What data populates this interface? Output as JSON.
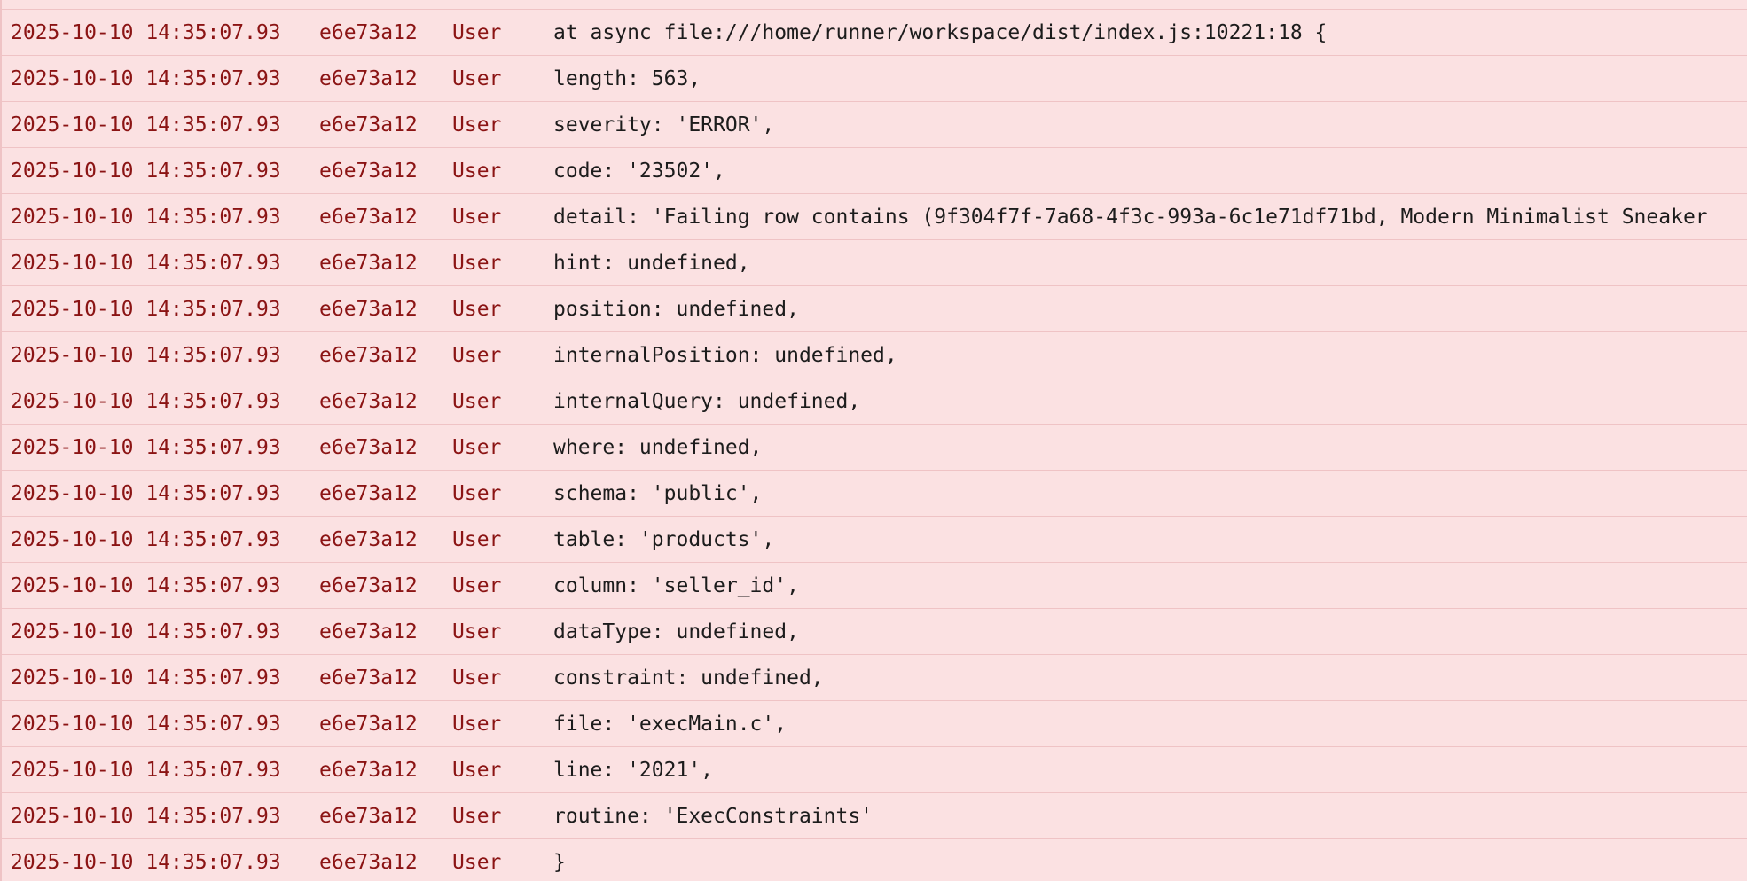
{
  "colors": {
    "background": "#fbe1e2",
    "separator": "#efc3c5",
    "meta_text": "#8b1414",
    "message_text": "#1c1c1c"
  },
  "log_rows": [
    {
      "timestamp": "2025-10-10 14:35:07.93",
      "id": "e6e73a12",
      "source": "User",
      "message": "at async file:///home/runner/workspace/dist/index.js:10221:18 {"
    },
    {
      "timestamp": "2025-10-10 14:35:07.93",
      "id": "e6e73a12",
      "source": "User",
      "message": "length: 563,"
    },
    {
      "timestamp": "2025-10-10 14:35:07.93",
      "id": "e6e73a12",
      "source": "User",
      "message": "severity: 'ERROR',"
    },
    {
      "timestamp": "2025-10-10 14:35:07.93",
      "id": "e6e73a12",
      "source": "User",
      "message": "code: '23502',"
    },
    {
      "timestamp": "2025-10-10 14:35:07.93",
      "id": "e6e73a12",
      "source": "User",
      "message": "detail: 'Failing row contains (9f304f7f-7a68-4f3c-993a-6c1e71df71bd, Modern Minimalist Sneaker"
    },
    {
      "timestamp": "2025-10-10 14:35:07.93",
      "id": "e6e73a12",
      "source": "User",
      "message": "hint: undefined,"
    },
    {
      "timestamp": "2025-10-10 14:35:07.93",
      "id": "e6e73a12",
      "source": "User",
      "message": "position: undefined,"
    },
    {
      "timestamp": "2025-10-10 14:35:07.93",
      "id": "e6e73a12",
      "source": "User",
      "message": "internalPosition: undefined,"
    },
    {
      "timestamp": "2025-10-10 14:35:07.93",
      "id": "e6e73a12",
      "source": "User",
      "message": "internalQuery: undefined,"
    },
    {
      "timestamp": "2025-10-10 14:35:07.93",
      "id": "e6e73a12",
      "source": "User",
      "message": "where: undefined,"
    },
    {
      "timestamp": "2025-10-10 14:35:07.93",
      "id": "e6e73a12",
      "source": "User",
      "message": "schema: 'public',"
    },
    {
      "timestamp": "2025-10-10 14:35:07.93",
      "id": "e6e73a12",
      "source": "User",
      "message": "table: 'products',"
    },
    {
      "timestamp": "2025-10-10 14:35:07.93",
      "id": "e6e73a12",
      "source": "User",
      "message": "column: 'seller_id',"
    },
    {
      "timestamp": "2025-10-10 14:35:07.93",
      "id": "e6e73a12",
      "source": "User",
      "message": "dataType: undefined,"
    },
    {
      "timestamp": "2025-10-10 14:35:07.93",
      "id": "e6e73a12",
      "source": "User",
      "message": "constraint: undefined,"
    },
    {
      "timestamp": "2025-10-10 14:35:07.93",
      "id": "e6e73a12",
      "source": "User",
      "message": "file: 'execMain.c',"
    },
    {
      "timestamp": "2025-10-10 14:35:07.93",
      "id": "e6e73a12",
      "source": "User",
      "message": "line: '2021',"
    },
    {
      "timestamp": "2025-10-10 14:35:07.93",
      "id": "e6e73a12",
      "source": "User",
      "message": "routine: 'ExecConstraints'"
    },
    {
      "timestamp": "2025-10-10 14:35:07.93",
      "id": "e6e73a12",
      "source": "User",
      "message": "}"
    }
  ]
}
